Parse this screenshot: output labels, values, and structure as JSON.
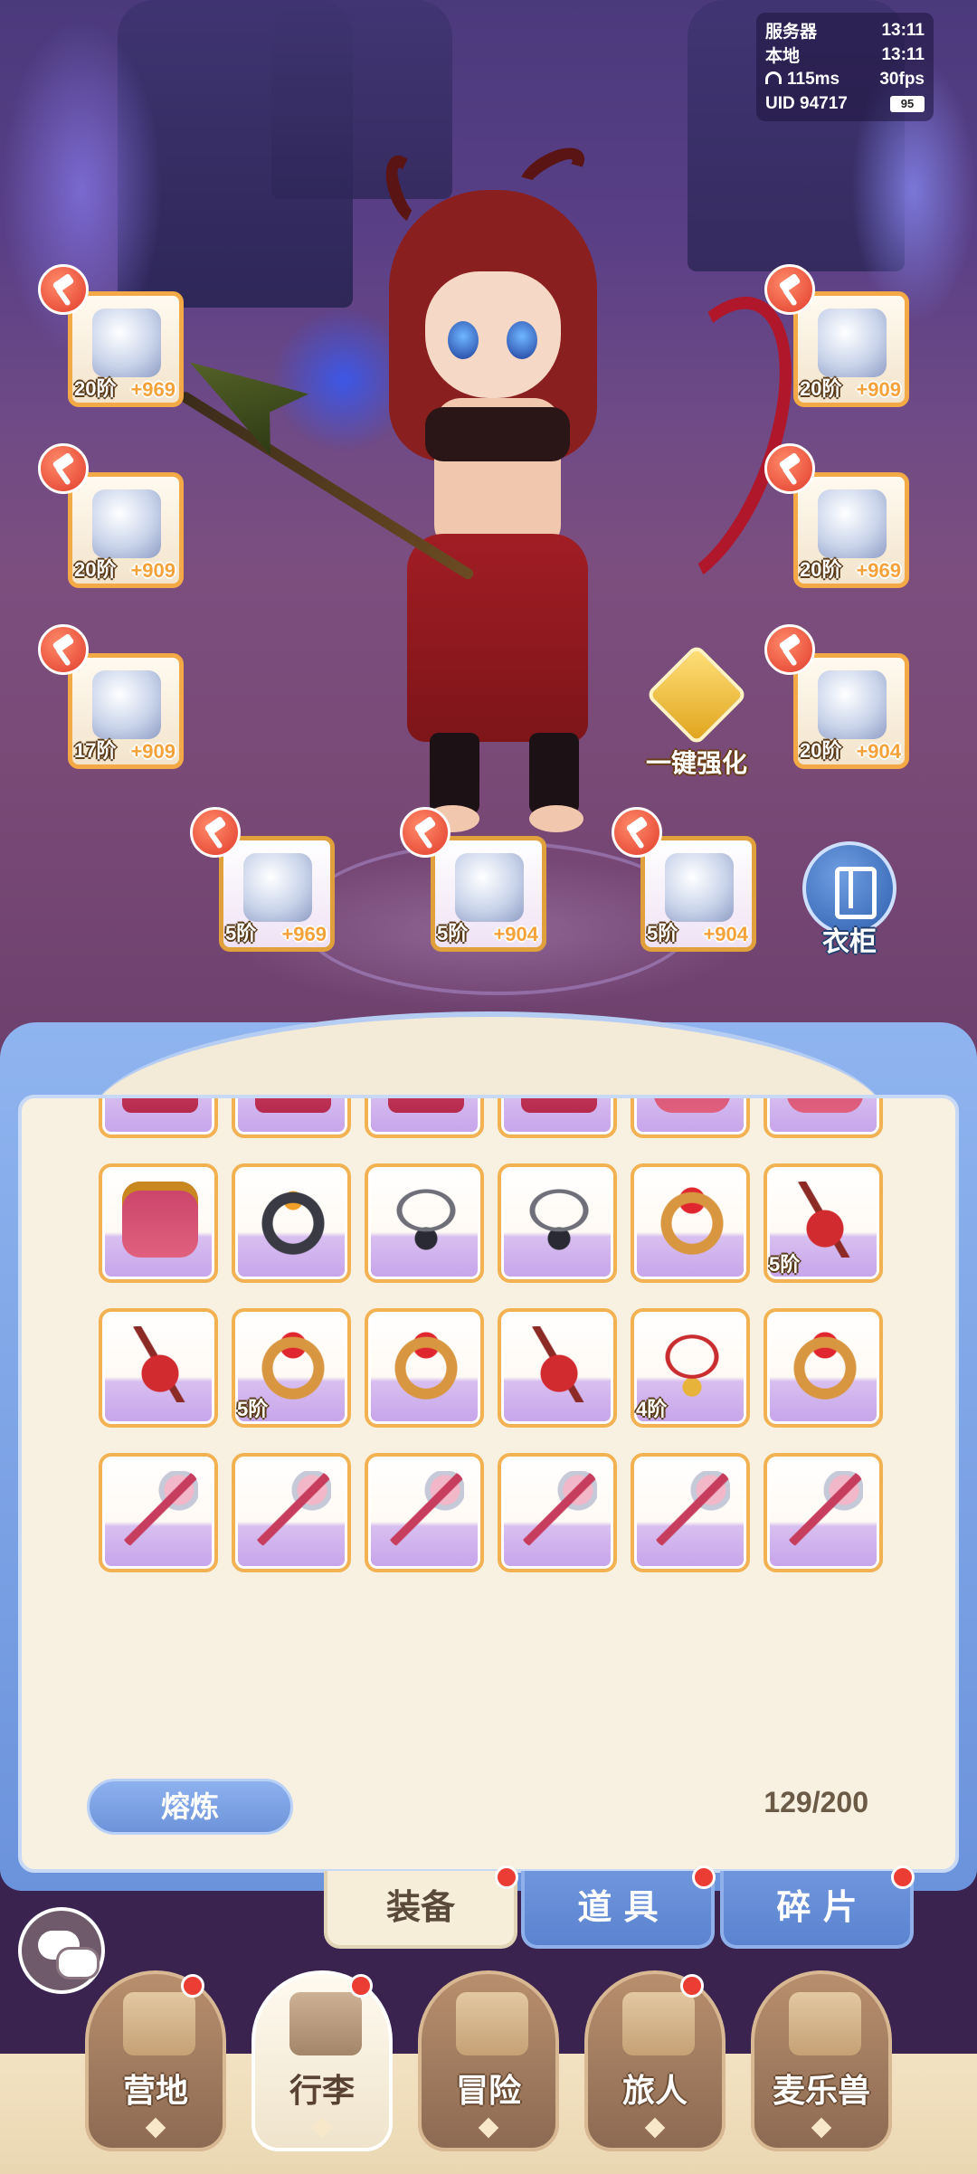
{
  "status": {
    "server_label": "服务器",
    "server_time": "13:11",
    "local_label": "本地",
    "local_time": "13:11",
    "ping": "115ms",
    "fps": "30fps",
    "uid_label": "UID",
    "uid": "94717",
    "battery": "95"
  },
  "equipment": {
    "weapon": {
      "tier": "20阶",
      "plus": "+969",
      "icon": "weapon-icon"
    },
    "armor": {
      "tier": "20阶",
      "plus": "+909",
      "icon": "armor-icon"
    },
    "cape": {
      "tier": "17阶",
      "plus": "+909",
      "icon": "cape-icon"
    },
    "helmet": {
      "tier": "20阶",
      "plus": "+909",
      "icon": "helmet-icon"
    },
    "gloves": {
      "tier": "20阶",
      "plus": "+969",
      "icon": "gloves-icon"
    },
    "boots": {
      "tier": "20阶",
      "plus": "+904",
      "icon": "boots-icon"
    },
    "ring": {
      "tier": "5阶",
      "plus": "+969",
      "icon": "ring-icon"
    },
    "necklace": {
      "tier": "5阶",
      "plus": "+904",
      "icon": "necklace-icon"
    },
    "pendant": {
      "tier": "5阶",
      "plus": "+904",
      "icon": "pendant-icon"
    }
  },
  "actions": {
    "one_key_enhance": "一键强化",
    "wardrobe": "衣柜"
  },
  "inventory": {
    "items": [
      {
        "type": "armor",
        "tier": ""
      },
      {
        "type": "armor",
        "tier": ""
      },
      {
        "type": "armor",
        "tier": ""
      },
      {
        "type": "armor",
        "tier": ""
      },
      {
        "type": "belt",
        "tier": ""
      },
      {
        "type": "belt",
        "tier": ""
      },
      {
        "type": "belt",
        "tier": ""
      },
      {
        "type": "dring",
        "tier": ""
      },
      {
        "type": "neck",
        "tier": ""
      },
      {
        "type": "neck",
        "tier": ""
      },
      {
        "type": "ring",
        "tier": ""
      },
      {
        "type": "pend",
        "tier": "5阶"
      },
      {
        "type": "pend",
        "tier": ""
      },
      {
        "type": "ring",
        "tier": "5阶"
      },
      {
        "type": "ring",
        "tier": ""
      },
      {
        "type": "pend",
        "tier": ""
      },
      {
        "type": "rneck",
        "tier": "4阶"
      },
      {
        "type": "ring",
        "tier": ""
      },
      {
        "type": "staff",
        "tier": ""
      },
      {
        "type": "staff",
        "tier": ""
      },
      {
        "type": "staff",
        "tier": ""
      },
      {
        "type": "staff",
        "tier": ""
      },
      {
        "type": "staff",
        "tier": ""
      },
      {
        "type": "staff",
        "tier": ""
      }
    ],
    "smelt_label": "熔炼",
    "capacity": "129/200"
  },
  "tabs": [
    {
      "label": "装备",
      "active": true
    },
    {
      "label": "道 具",
      "active": false
    },
    {
      "label": "碎 片",
      "active": false
    }
  ],
  "nav": [
    {
      "label": "营地",
      "icon": "castle-icon"
    },
    {
      "label": "行李",
      "icon": "luggage-icon"
    },
    {
      "label": "冒险",
      "icon": "swords-icon"
    },
    {
      "label": "旅人",
      "icon": "traveler-icon"
    },
    {
      "label": "麦乐兽",
      "icon": "pet-icon"
    }
  ],
  "colors": {
    "accent_orange": "#f3a945",
    "panel_blue": "#6b93dc",
    "badge_red": "#ec3d35"
  }
}
